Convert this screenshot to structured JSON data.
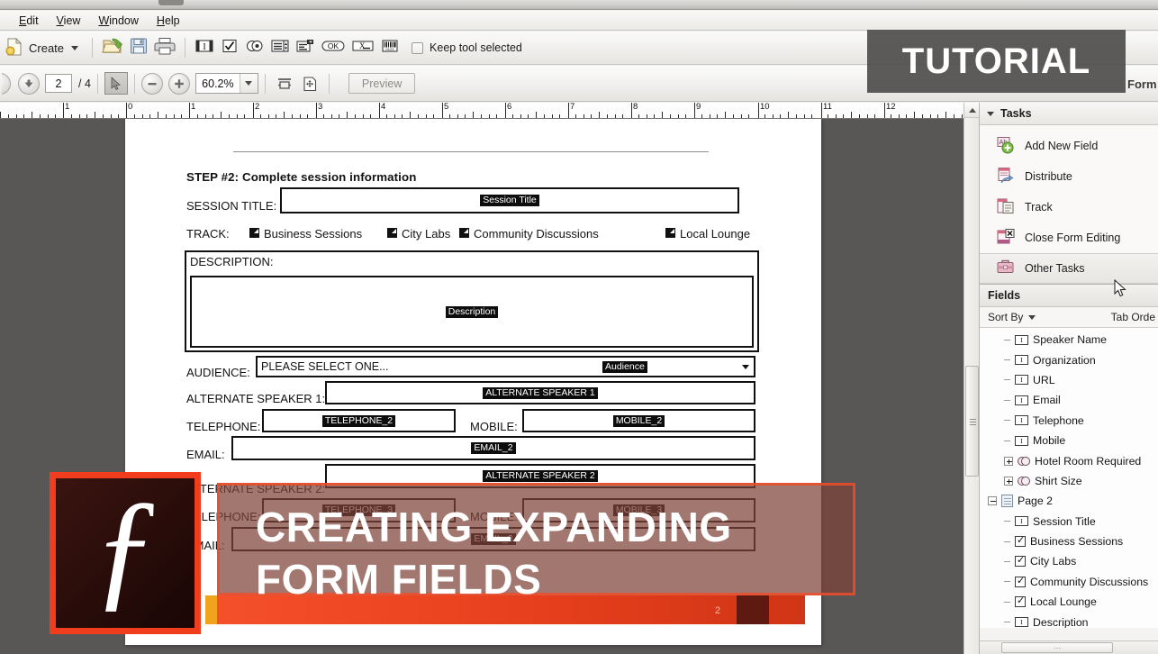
{
  "menubar": {
    "items": [
      {
        "label": "Edit",
        "mnemonic": "E"
      },
      {
        "label": "View",
        "mnemonic": "V"
      },
      {
        "label": "Window",
        "mnemonic": "W"
      },
      {
        "label": "Help",
        "mnemonic": "H"
      }
    ]
  },
  "toolbar": {
    "create_label": "Create",
    "keep_tool_label": "Keep tool selected",
    "icons": [
      "open-folder-icon",
      "save-icon",
      "print-icon",
      "text-field-icon",
      "check-box-icon",
      "radio-button-icon",
      "list-box-icon",
      "dropdown-icon",
      "button-ok-icon",
      "digital-signature-icon",
      "barcode-icon"
    ]
  },
  "navbar": {
    "page_current": "2",
    "page_total": "/ 4",
    "zoom_value": "60.2%",
    "preview_label": "Preview",
    "icons": [
      "down-arrow-icon",
      "select-tool-icon",
      "zoom-out-icon",
      "zoom-in-icon",
      "fit-width-icon",
      "fit-page-icon"
    ]
  },
  "ruler": {
    "labels": [
      "1",
      "0",
      "1",
      "2",
      "3",
      "4",
      "5",
      "6",
      "7",
      "8",
      "9",
      "10",
      "11",
      "12"
    ],
    "unit": "inches"
  },
  "document": {
    "step_heading": "STEP #2: Complete session information",
    "rows": [
      {
        "label": "SESSION TITLE:",
        "field_tag": "Session Title"
      },
      {
        "label": "DESCRIPTION:",
        "field_tag": "Description"
      },
      {
        "label": "AUDIENCE:",
        "field_tag": "Audience",
        "value": "PLEASE SELECT ONE...",
        "type": "dropdown"
      },
      {
        "label": "ALTERNATE SPEAKER 1:",
        "field_tag": "ALTERNATE SPEAKER 1"
      },
      {
        "label": "TELEPHONE:",
        "field_tag": "TELEPHONE_2"
      },
      {
        "label": "MOBILE:",
        "field_tag": "MOBILE_2"
      },
      {
        "label": "EMAIL:",
        "field_tag": "EMAIL_2"
      },
      {
        "label": "ALTERNATE SPEAKER 2:",
        "field_tag": "ALTERNATE SPEAKER 2"
      },
      {
        "label": "TELEPHONE:",
        "field_tag": "TELEPHONE_3"
      },
      {
        "label": "MOBILE:",
        "field_tag": "MOBILE_3"
      },
      {
        "label": "EMAIL:",
        "field_tag": "EMAIL_3"
      }
    ],
    "track_label": "TRACK:",
    "track_options": [
      "Business Sessions",
      "City Labs",
      "Community Discussions",
      "Local Lounge"
    ]
  },
  "tasks_panel": {
    "title": "Tasks",
    "items": [
      {
        "label": "Add New Field",
        "icon": "add-new-field-icon",
        "selected": false
      },
      {
        "label": "Distribute",
        "icon": "distribute-icon",
        "selected": false
      },
      {
        "label": "Track",
        "icon": "track-icon",
        "selected": false
      },
      {
        "label": "Close Form Editing",
        "icon": "close-form-editing-icon",
        "selected": false
      },
      {
        "label": "Other Tasks",
        "icon": "other-tasks-icon",
        "selected": true
      }
    ]
  },
  "fields_panel": {
    "title": "Fields",
    "sort_by_label": "Sort By",
    "tab_order_label": "Tab Orde",
    "tree": [
      {
        "label": "Speaker Name",
        "icon": "text-field-icon",
        "level": 2,
        "expander": false
      },
      {
        "label": "Organization",
        "icon": "text-field-icon",
        "level": 2,
        "expander": false
      },
      {
        "label": "URL",
        "icon": "text-field-icon",
        "level": 2,
        "expander": false
      },
      {
        "label": "Email",
        "icon": "text-field-icon",
        "level": 2,
        "expander": false
      },
      {
        "label": "Telephone",
        "icon": "text-field-icon",
        "level": 2,
        "expander": false
      },
      {
        "label": "Mobile",
        "icon": "text-field-icon",
        "level": 2,
        "expander": false
      },
      {
        "label": "Hotel Room Required",
        "icon": "radio-group-icon",
        "level": 2,
        "expander": "plus"
      },
      {
        "label": "Shirt Size",
        "icon": "radio-group-icon",
        "level": 2,
        "expander": "plus"
      },
      {
        "label": "Page 2",
        "icon": "page-icon",
        "level": 1,
        "expander": "minus"
      },
      {
        "label": "Session Title",
        "icon": "text-field-icon",
        "level": 2,
        "expander": false
      },
      {
        "label": "Business Sessions",
        "icon": "check-box-icon",
        "level": 2,
        "expander": false
      },
      {
        "label": "City Labs",
        "icon": "check-box-icon",
        "level": 2,
        "expander": false
      },
      {
        "label": "Community Discussions",
        "icon": "check-box-icon",
        "level": 2,
        "expander": false
      },
      {
        "label": "Local Lounge",
        "icon": "check-box-icon",
        "level": 2,
        "expander": false
      },
      {
        "label": "Description",
        "icon": "text-field-icon",
        "level": 2,
        "expander": false
      }
    ]
  },
  "overlay": {
    "tutorial_badge": "TUTORIAL",
    "form_text": "Form",
    "title_line1": "CREATING EXPANDING",
    "title_line2": "FORM FIELDS",
    "logo_glyph": "ƒ",
    "progress_num": "2",
    "accent_red": "#ee4d2d",
    "banner_gray": "#504f4e"
  }
}
